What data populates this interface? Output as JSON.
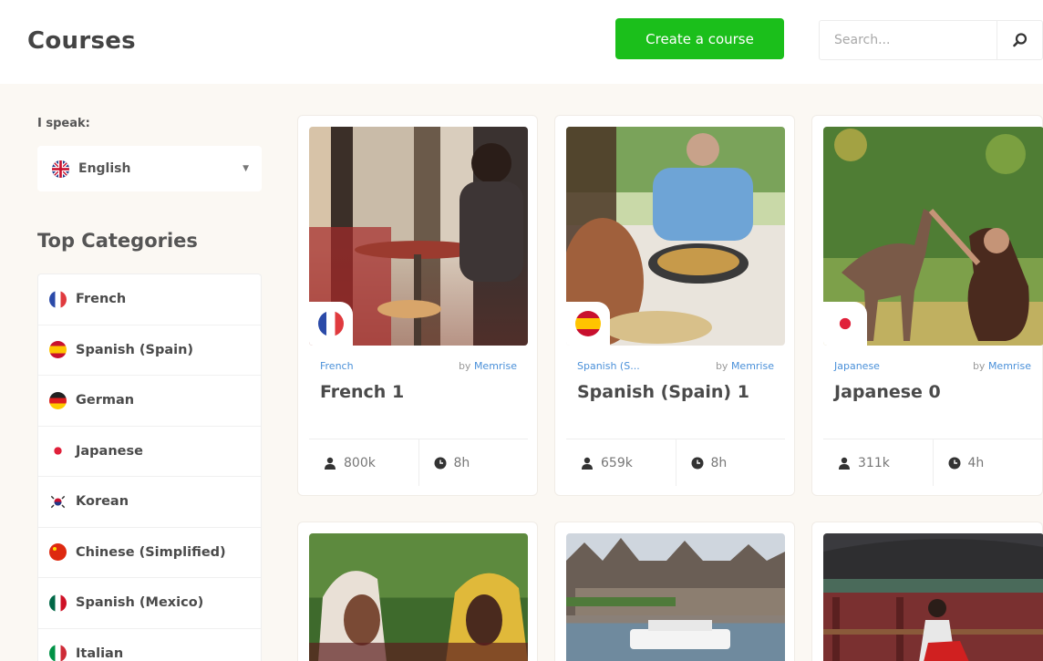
{
  "header": {
    "title": "Courses",
    "create_label": "Create a course",
    "search_placeholder": "Search..."
  },
  "sidebar": {
    "speak_label": "I speak:",
    "selected_language": "English",
    "categories_heading": "Top Categories",
    "categories": [
      {
        "label": "French",
        "icon": "flag-fr"
      },
      {
        "label": "Spanish (Spain)",
        "icon": "flag-es"
      },
      {
        "label": "German",
        "icon": "flag-de"
      },
      {
        "label": "Japanese",
        "icon": "flag-jp"
      },
      {
        "label": "Korean",
        "icon": "flag-kr"
      },
      {
        "label": "Chinese (Simplified)",
        "icon": "flag-cn"
      },
      {
        "label": "Spanish (Mexico)",
        "icon": "flag-mx"
      },
      {
        "label": "Italian",
        "icon": "flag-it"
      }
    ]
  },
  "courses": [
    {
      "category": "French",
      "by_prefix": "by",
      "author": "Memrise",
      "title": "French 1",
      "learners": "800k",
      "duration": "8h",
      "icon": "flag-fr"
    },
    {
      "category": "Spanish (S...",
      "by_prefix": "by",
      "author": "Memrise",
      "title": "Spanish (Spain) 1",
      "learners": "659k",
      "duration": "8h",
      "icon": "flag-es"
    },
    {
      "category": "Japanese",
      "by_prefix": "by",
      "author": "Memrise",
      "title": "Japanese 0",
      "learners": "311k",
      "duration": "4h",
      "icon": "flag-jp"
    }
  ],
  "colors": {
    "accent_green": "#1bbf1b",
    "link_blue": "#4a90d9",
    "page_bg": "#fbf8f3"
  }
}
